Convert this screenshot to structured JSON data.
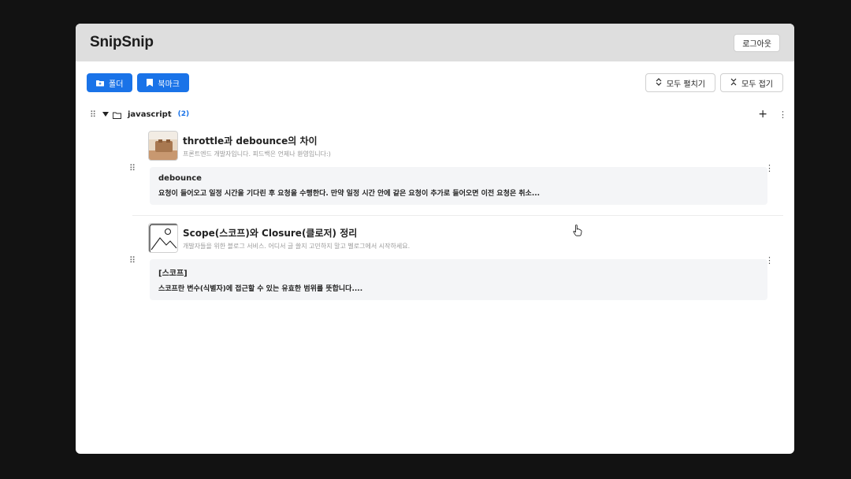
{
  "app": {
    "name": "SnipSnip"
  },
  "header": {
    "logout_label": "로그아웃"
  },
  "toolbar": {
    "folder_label": "폴더",
    "bookmark_label": "북마크",
    "expand_all_label": "모두 펼치기",
    "collapse_all_label": "모두 접기"
  },
  "folder": {
    "name": "javascript",
    "count": "(2)"
  },
  "bookmarks": [
    {
      "title": "throttle과 debounce의 차이",
      "subtitle": "프론트엔드 개발자입니다. 피드백은 언제나 환영입니다:)",
      "snippet_title": "debounce",
      "snippet_body": "요청이 들어오고 일정 시간을 기다린 후 요청을 수행한다. 만약 일정 시간 안에 같은 요청이 추가로 들어오면 이전 요청은 취소..."
    },
    {
      "title": "Scope(스코프)와 Closure(클로저) 정리",
      "subtitle": "개발자들을 위한 블로그 서비스. 어디서 글 쓸지 고민하지 말고 벨로그에서 시작하세요.",
      "snippet_title": "[스코프]",
      "snippet_body": "스코프란 변수(식별자)에 접근할 수 있는 유효한 범위를 뜻합니다...."
    }
  ],
  "colors": {
    "accent": "#1a73e8",
    "header_bg": "#dedede",
    "snippet_bg": "#f4f5f7"
  }
}
